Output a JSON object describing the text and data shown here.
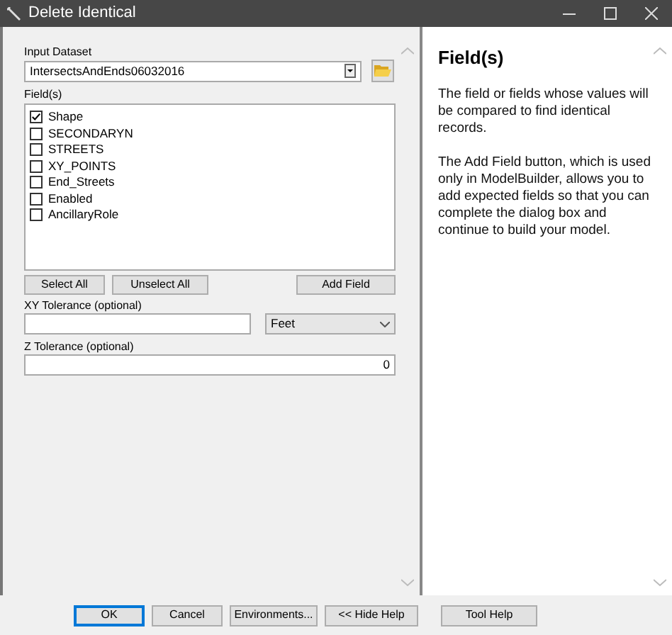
{
  "window": {
    "title": "Delete Identical"
  },
  "input_dataset": {
    "label": "Input Dataset",
    "value": "IntersectsAndEnds06032016"
  },
  "fields": {
    "label": "Field(s)",
    "items": [
      {
        "name": "Shape",
        "checked": true
      },
      {
        "name": "SECONDARYN",
        "checked": false
      },
      {
        "name": "STREETS",
        "checked": false
      },
      {
        "name": "XY_POINTS",
        "checked": false
      },
      {
        "name": "End_Streets",
        "checked": false
      },
      {
        "name": "Enabled",
        "checked": false
      },
      {
        "name": "AncillaryRole",
        "checked": false
      }
    ]
  },
  "field_buttons": [
    "Select All",
    "Unselect All",
    "Add Field"
  ],
  "xy_tolerance": {
    "label": "XY Tolerance (optional)",
    "unit": "Feet"
  },
  "z_tolerance": {
    "label": "Z Tolerance (optional)",
    "value": "0"
  },
  "help": {
    "title": "Field(s)",
    "paragraphs": [
      "The field or fields whose values will be compared to find identical records.",
      "The Add Field button, which is used only in ModelBuilder, allows you to add expected fields so that you can complete the dialog box and continue to build your model."
    ]
  },
  "buttons": [
    {
      "label": "OK",
      "default": true
    },
    {
      "label": "Cancel",
      "default": false
    },
    {
      "label": "Environments...",
      "default": false
    },
    {
      "label": "<< Hide Help",
      "default": false
    },
    {
      "label": "Tool Help",
      "default": false
    }
  ]
}
